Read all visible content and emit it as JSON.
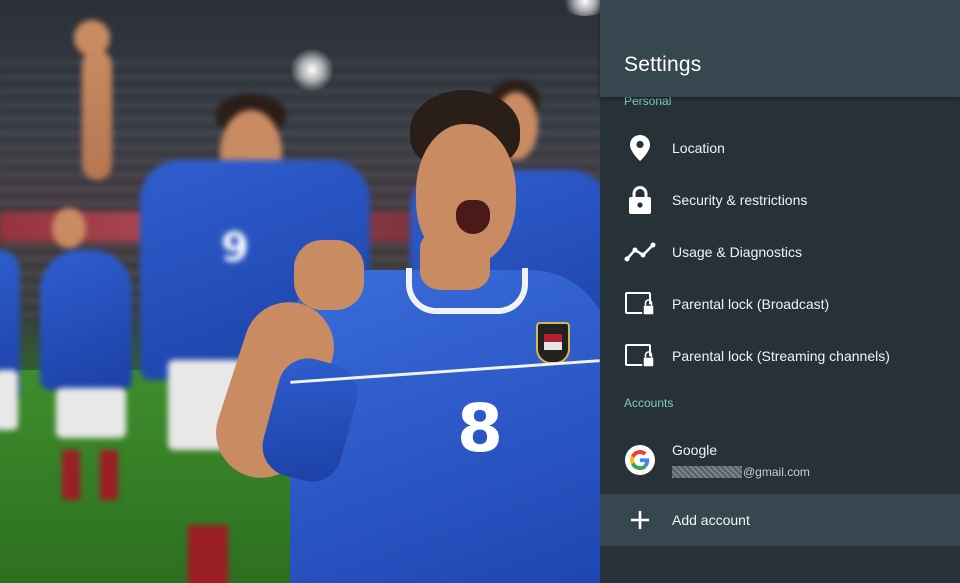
{
  "background": {
    "jersey_number_front": "8",
    "jersey_number_back": "9"
  },
  "settings": {
    "title": "Settings",
    "sections": [
      {
        "title": "Personal"
      },
      {
        "title": "Accounts"
      }
    ],
    "personal_items": [
      {
        "label": "Location",
        "icon": "location-pin-icon"
      },
      {
        "label": "Security & restrictions",
        "icon": "lock-icon"
      },
      {
        "label": "Usage & Diagnostics",
        "icon": "diagnostics-graph-icon"
      },
      {
        "label": "Parental lock (Broadcast)",
        "icon": "parental-lock-icon"
      },
      {
        "label": "Parental lock (Streaming channels)",
        "icon": "parental-lock-icon"
      }
    ],
    "accounts": [
      {
        "label": "Google",
        "email_suffix": "@gmail.com",
        "icon": "google-icon"
      }
    ],
    "add_account": {
      "label": "Add account",
      "icon": "plus-icon",
      "selected": true
    }
  },
  "colors": {
    "panel_bg": "#263238",
    "header_bg": "#37474f",
    "section_accent": "#80cbc4",
    "selected_bg": "#37474f"
  }
}
